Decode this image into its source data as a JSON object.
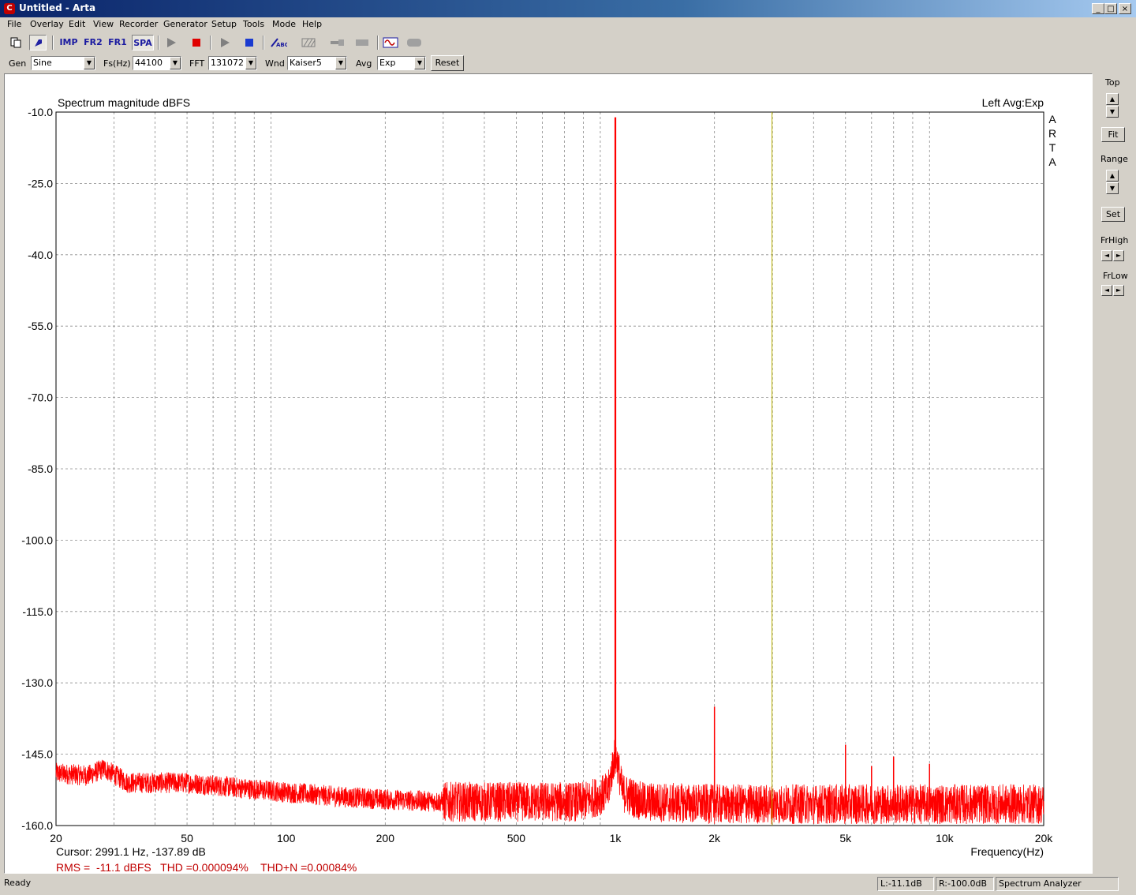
{
  "window": {
    "title": "Untitled - Arta",
    "icon": "arta-app-icon",
    "controls": [
      "minimize-icon",
      "maximize-icon",
      "close-icon"
    ]
  },
  "menu": [
    "File",
    "Overlay",
    "Edit",
    "View",
    "Recorder",
    "Generator",
    "Setup",
    "Tools",
    "Mode",
    "Help"
  ],
  "toolbar": {
    "buttons": [
      {
        "name": "new-document-icon",
        "label": ""
      },
      {
        "name": "cursor-tool-icon",
        "label": ""
      },
      {
        "name": "imp-mode-button",
        "label": "IMP"
      },
      {
        "name": "fr2-mode-button",
        "label": "FR2"
      },
      {
        "name": "fr1-mode-button",
        "label": "FR1"
      },
      {
        "name": "spa-mode-button",
        "label": "SPA"
      },
      {
        "name": "play-icon",
        "label": ""
      },
      {
        "name": "record-stop-icon",
        "label": ""
      },
      {
        "name": "play-generator-icon",
        "label": ""
      },
      {
        "name": "stop-icon",
        "label": ""
      },
      {
        "name": "abc-overlay-icon",
        "label": ""
      },
      {
        "name": "hatched-icon",
        "label": ""
      },
      {
        "name": "probe-icon",
        "label": ""
      },
      {
        "name": "gray-rect-icon",
        "label": ""
      },
      {
        "name": "sine-wave-icon",
        "label": ""
      },
      {
        "name": "gray-rounded-icon",
        "label": ""
      }
    ],
    "accent": "#1a1aa0"
  },
  "controls": {
    "gen_label": "Gen",
    "gen_value": "Sine",
    "fs_label": "Fs(Hz)",
    "fs_value": "44100",
    "fft_label": "FFT",
    "fft_value": "131072",
    "wnd_label": "Wnd",
    "wnd_value": "Kaiser5",
    "avg_label": "Avg",
    "avg_value": "Exp",
    "reset_label": "Reset"
  },
  "side": {
    "top_label": "Top",
    "fit_label": "Fit",
    "range_label": "Range",
    "set_label": "Set",
    "frhigh_label": "FrHigh",
    "frlow_label": "FrLow"
  },
  "info": {
    "cursor": "Cursor:  2991.1 Hz, -137.89 dB",
    "metrics": "RMS =  -11.1 dBFS   THD =0.000094%    THD+N =0.00084%",
    "metrics_color": "#c00000"
  },
  "status": {
    "ready": "Ready",
    "left": "L:-11.1dB",
    "right": "R:-100.0dB",
    "mode": "Spectrum Analyzer"
  },
  "chart_data": {
    "type": "line",
    "title": "Spectrum magnitude dBFS",
    "top_right_label": "Left  Avg:Exp",
    "watermark": "ARTA",
    "xlabel": "Frequency(Hz)",
    "ylabel": "",
    "xscale": "log",
    "xlim": [
      20,
      20000
    ],
    "ylim": [
      -160,
      -10
    ],
    "x_ticks": [
      {
        "v": 20,
        "label": "20"
      },
      {
        "v": 50,
        "label": "50"
      },
      {
        "v": 100,
        "label": "100"
      },
      {
        "v": 200,
        "label": "200"
      },
      {
        "v": 500,
        "label": "500"
      },
      {
        "v": 1000,
        "label": "1k"
      },
      {
        "v": 2000,
        "label": "2k"
      },
      {
        "v": 5000,
        "label": "5k"
      },
      {
        "v": 10000,
        "label": "10k"
      },
      {
        "v": 20000,
        "label": "20k"
      }
    ],
    "y_ticks": [
      {
        "v": -10,
        "label": "-10.0"
      },
      {
        "v": -25,
        "label": "-25.0"
      },
      {
        "v": -40,
        "label": "-40.0"
      },
      {
        "v": -55,
        "label": "-55.0"
      },
      {
        "v": -70,
        "label": "-70.0"
      },
      {
        "v": -85,
        "label": "-85.0"
      },
      {
        "v": -100,
        "label": "-100.0"
      },
      {
        "v": -115,
        "label": "-115.0"
      },
      {
        "v": -130,
        "label": "-130.0"
      },
      {
        "v": -145,
        "label": "-145.0"
      },
      {
        "v": -160,
        "label": "-160.0"
      }
    ],
    "grid": true,
    "series_color": "#ff0000",
    "cursor_color": "#b8b000",
    "cursor_x": 2991.1,
    "noise_floor": [
      {
        "x": 20,
        "y": -149
      },
      {
        "x": 25,
        "y": -149.5
      },
      {
        "x": 28,
        "y": -148
      },
      {
        "x": 33,
        "y": -151
      },
      {
        "x": 40,
        "y": -151
      },
      {
        "x": 50,
        "y": -151
      },
      {
        "x": 70,
        "y": -152
      },
      {
        "x": 100,
        "y": -153
      },
      {
        "x": 150,
        "y": -154
      },
      {
        "x": 200,
        "y": -154.5
      },
      {
        "x": 300,
        "y": -155
      },
      {
        "x": 500,
        "y": -155
      },
      {
        "x": 800,
        "y": -155
      },
      {
        "x": 950,
        "y": -153
      },
      {
        "x": 990,
        "y": -146
      },
      {
        "x": 1010,
        "y": -146
      },
      {
        "x": 1050,
        "y": -153
      },
      {
        "x": 1200,
        "y": -155
      },
      {
        "x": 2000,
        "y": -155.5
      },
      {
        "x": 5000,
        "y": -155.5
      },
      {
        "x": 10000,
        "y": -155.5
      },
      {
        "x": 20000,
        "y": -155.5
      }
    ],
    "peaks": [
      {
        "x": 1000,
        "y": -11.1
      },
      {
        "x": 2000,
        "y": -135
      },
      {
        "x": 5000,
        "y": -143
      },
      {
        "x": 6000,
        "y": -147.5
      },
      {
        "x": 7000,
        "y": -145.5
      },
      {
        "x": 9000,
        "y": -147
      }
    ]
  }
}
